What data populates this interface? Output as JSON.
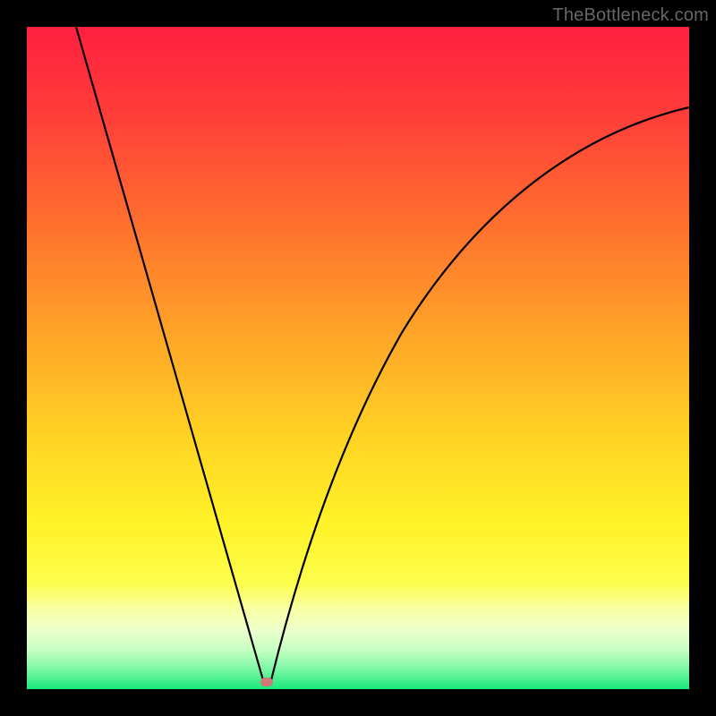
{
  "watermark": "TheBottleneck.com",
  "chart_data": {
    "type": "line",
    "title": "",
    "xlabel": "",
    "ylabel": "",
    "xlim": [
      0,
      100
    ],
    "ylim": [
      0,
      100
    ],
    "grid": false,
    "legend": false,
    "annotations": [
      {
        "name": "optimal-point",
        "x": 36,
        "y": 1
      }
    ],
    "background_gradient": {
      "direction": "vertical",
      "stops": [
        {
          "pos": 0.0,
          "color": "#ff203f"
        },
        {
          "pos": 0.12,
          "color": "#ff3a3a"
        },
        {
          "pos": 0.28,
          "color": "#ff6a2f"
        },
        {
          "pos": 0.45,
          "color": "#ffa028"
        },
        {
          "pos": 0.62,
          "color": "#ffd324"
        },
        {
          "pos": 0.75,
          "color": "#fff227"
        },
        {
          "pos": 0.84,
          "color": "#fdfe4c"
        },
        {
          "pos": 0.88,
          "color": "#f8ffa5"
        },
        {
          "pos": 0.91,
          "color": "#edffca"
        },
        {
          "pos": 0.94,
          "color": "#c8ffc3"
        },
        {
          "pos": 0.97,
          "color": "#7cf8a6"
        },
        {
          "pos": 1.0,
          "color": "#17e87b"
        }
      ]
    },
    "series": [
      {
        "name": "bottleneck-curve",
        "x": [
          7,
          10,
          14,
          18,
          22,
          26,
          30,
          33,
          35,
          36,
          37,
          39,
          42,
          46,
          50,
          55,
          60,
          66,
          72,
          78,
          85,
          92,
          100
        ],
        "y": [
          100,
          89,
          75,
          61,
          47,
          33,
          19,
          8,
          2,
          1,
          2,
          8,
          20,
          33,
          44,
          54,
          62,
          69,
          75,
          80,
          84,
          86,
          88
        ]
      }
    ]
  }
}
